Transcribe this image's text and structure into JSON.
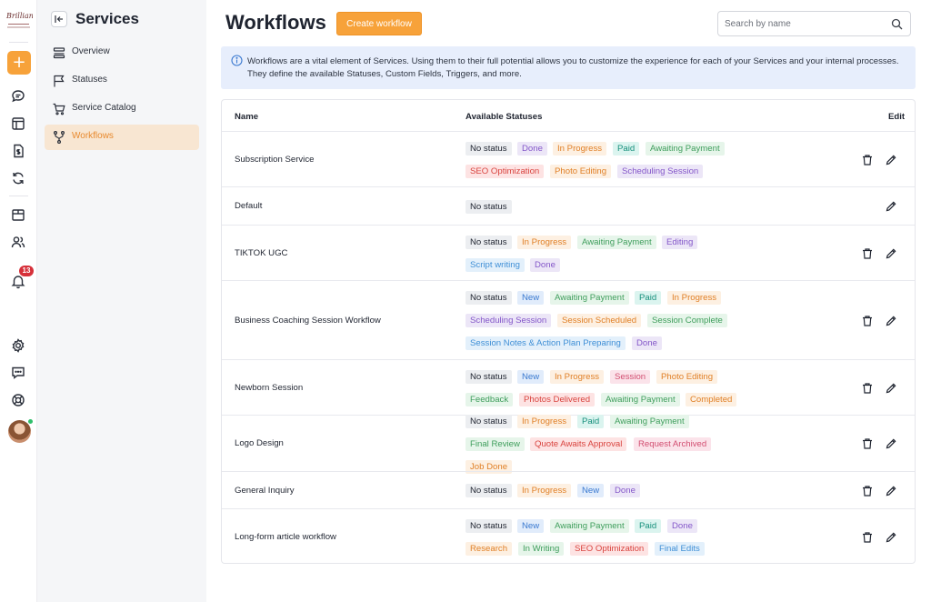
{
  "logo": {
    "script": "Brilliance"
  },
  "notifications": {
    "count": "13"
  },
  "subnav": {
    "title": "Services",
    "items": [
      {
        "label": "Overview"
      },
      {
        "label": "Statuses"
      },
      {
        "label": "Service Catalog"
      },
      {
        "label": "Workflows"
      }
    ]
  },
  "header": {
    "title": "Workflows",
    "create_label": "Create workflow",
    "search_placeholder": "Search by name"
  },
  "info": {
    "text": "Workflows are a vital element of Services. Using them to their full potential allows you to customize the experience for each of your Services and your internal processes. They define the available Statuses, Custom Fields, Triggers, and more."
  },
  "table": {
    "columns": {
      "name": "Name",
      "statuses": "Available Statuses",
      "edit": "Edit"
    },
    "rows": [
      {
        "name": "Subscription Service",
        "deletable": true,
        "statuses": [
          [
            "No status",
            "gray"
          ],
          [
            "Done",
            "purple"
          ],
          [
            "In Progress",
            "orange"
          ],
          [
            "Paid",
            "teal"
          ],
          [
            "Awaiting Payment",
            "green"
          ],
          [
            "SEO Optimization",
            "red"
          ],
          [
            "Photo Editing",
            "orange"
          ],
          [
            "Scheduling Session",
            "purple"
          ]
        ]
      },
      {
        "name": "Default",
        "deletable": false,
        "statuses": [
          [
            "No status",
            "gray"
          ]
        ]
      },
      {
        "name": "TIKTOK UGC",
        "deletable": true,
        "statuses": [
          [
            "No status",
            "gray"
          ],
          [
            "In Progress",
            "orange"
          ],
          [
            "Awaiting Payment",
            "green"
          ],
          [
            "Editing",
            "purple"
          ],
          [
            "Script writing",
            "lightblue"
          ],
          [
            "Done",
            "purple"
          ]
        ]
      },
      {
        "name": "Business Coaching Session Workflow",
        "deletable": true,
        "statuses": [
          [
            "No status",
            "gray"
          ],
          [
            "New",
            "blue"
          ],
          [
            "Awaiting Payment",
            "green"
          ],
          [
            "Paid",
            "teal"
          ],
          [
            "In Progress",
            "orange"
          ],
          [
            "Scheduling Session",
            "purple"
          ],
          [
            "Session Scheduled",
            "orange"
          ],
          [
            "Session Complete",
            "green"
          ],
          [
            "Session Notes & Action Plan Preparing",
            "lightblue"
          ],
          [
            "Done",
            "purple"
          ]
        ]
      },
      {
        "name": "Newborn Session",
        "deletable": true,
        "statuses": [
          [
            "No status",
            "gray"
          ],
          [
            "New",
            "blue"
          ],
          [
            "In Progress",
            "orange"
          ],
          [
            "Session",
            "pink"
          ],
          [
            "Photo Editing",
            "orange"
          ],
          [
            "Feedback",
            "green"
          ],
          [
            "Photos Delivered",
            "red"
          ],
          [
            "Awaiting Payment",
            "green"
          ],
          [
            "Completed",
            "orange"
          ]
        ]
      },
      {
        "name": "Logo Design",
        "deletable": true,
        "statuses": [
          [
            "No status",
            "gray"
          ],
          [
            "In Progress",
            "orange"
          ],
          [
            "Paid",
            "teal"
          ],
          [
            "Awaiting Payment",
            "green"
          ],
          [
            "Final Review",
            "green"
          ],
          [
            "Quote Awaits Approval",
            "red"
          ],
          [
            "Request Archived",
            "pink"
          ],
          [
            "Job Done",
            "orange"
          ]
        ]
      },
      {
        "name": "General Inquiry",
        "deletable": true,
        "statuses": [
          [
            "No status",
            "gray"
          ],
          [
            "In Progress",
            "orange"
          ],
          [
            "New",
            "blue"
          ],
          [
            "Done",
            "purple"
          ]
        ]
      },
      {
        "name": "Long-form article workflow",
        "deletable": true,
        "statuses": [
          [
            "No status",
            "gray"
          ],
          [
            "New",
            "blue"
          ],
          [
            "Awaiting Payment",
            "green"
          ],
          [
            "Paid",
            "teal"
          ],
          [
            "Done",
            "purple"
          ],
          [
            "Research",
            "orange"
          ],
          [
            "In Writing",
            "green"
          ],
          [
            "SEO Optimization",
            "red"
          ],
          [
            "Final Edits",
            "lightblue"
          ]
        ]
      }
    ]
  },
  "colors": {
    "accent": "#f7a23a",
    "active_nav_bg": "#f8e6d2",
    "info_bg": "#e7eefc"
  }
}
